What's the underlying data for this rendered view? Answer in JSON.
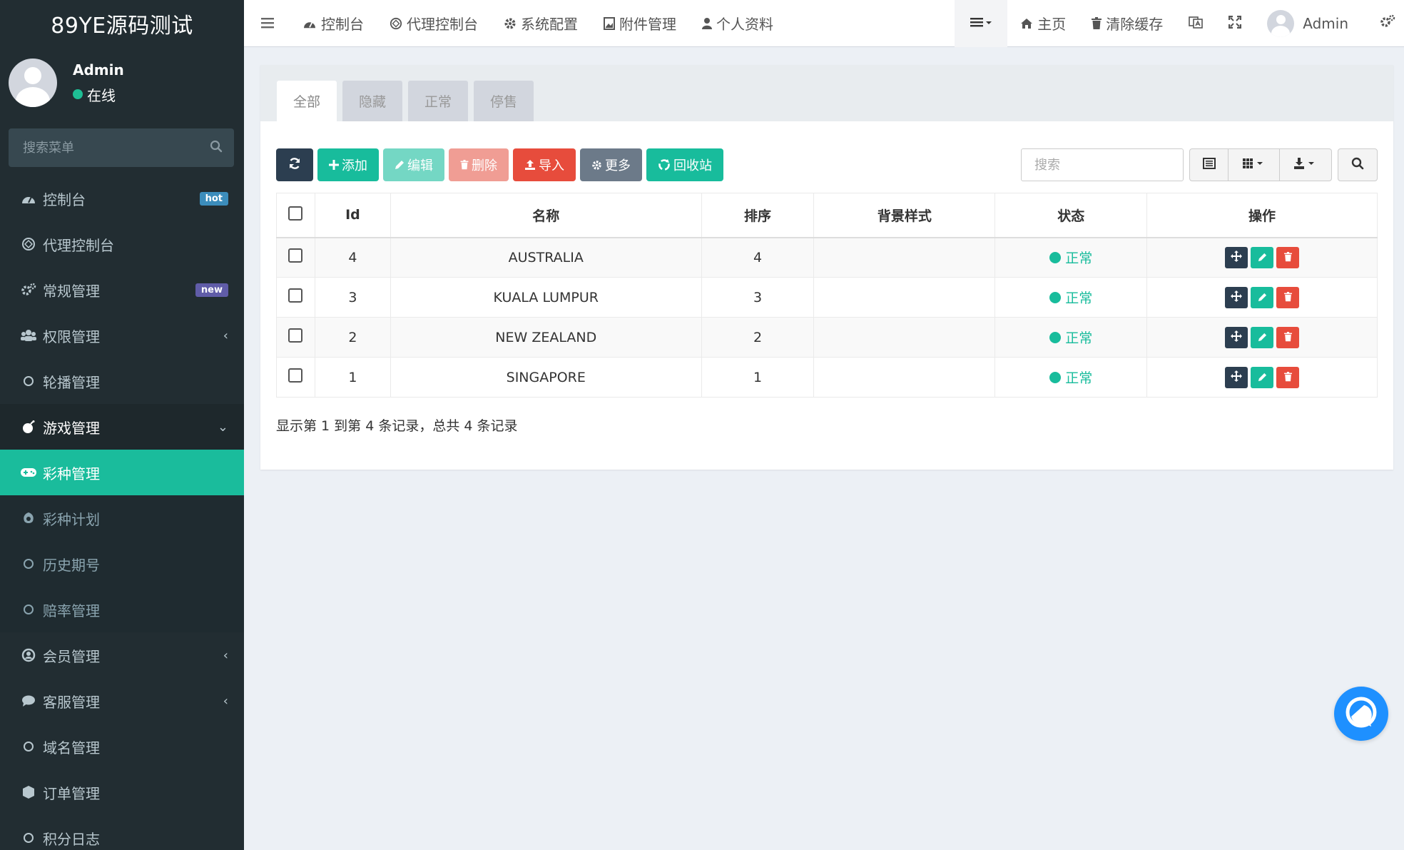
{
  "sidebar": {
    "logo": "89YE源码测试",
    "user": {
      "name": "Admin",
      "status": "在线"
    },
    "search_placeholder": "搜索菜单",
    "items": [
      {
        "label": "控制台",
        "icon": "dashboard-icon",
        "badge": "hot"
      },
      {
        "label": "代理控制台",
        "icon": "dashboard-icon"
      },
      {
        "label": "常规管理",
        "icon": "cogs-icon",
        "badge": "new"
      },
      {
        "label": "权限管理",
        "icon": "users-icon",
        "chevron": "left"
      },
      {
        "label": "轮播管理",
        "icon": "circle-icon"
      },
      {
        "label": "游戏管理",
        "icon": "bomb-icon",
        "chevron": "down"
      },
      {
        "label": "彩种管理",
        "icon": "gamepad-icon"
      },
      {
        "label": "彩种计划",
        "icon": "rebel-icon"
      },
      {
        "label": "历史期号",
        "icon": "circle-icon"
      },
      {
        "label": "赔率管理",
        "icon": "circle-icon"
      },
      {
        "label": "会员管理",
        "icon": "user-circle-icon",
        "chevron": "left"
      },
      {
        "label": "客服管理",
        "icon": "comment-icon",
        "chevron": "left"
      },
      {
        "label": "域名管理",
        "icon": "circle-icon"
      },
      {
        "label": "订单管理",
        "icon": "cube-icon"
      },
      {
        "label": "积分日志",
        "icon": "circle-icon"
      }
    ]
  },
  "topnav": {
    "left": [
      {
        "label": "控制台",
        "icon": "dashboard-icon"
      },
      {
        "label": "代理控制台",
        "icon": "dashboard-icon"
      },
      {
        "label": "系统配置",
        "icon": "gear-icon"
      },
      {
        "label": "附件管理",
        "icon": "image-icon"
      },
      {
        "label": "个人资料",
        "icon": "user-icon"
      }
    ],
    "right": [
      {
        "label": "主页",
        "icon": "home-icon"
      },
      {
        "label": "清除缓存",
        "icon": "trash-icon"
      }
    ],
    "username": "Admin"
  },
  "tabs": [
    "全部",
    "隐藏",
    "正常",
    "停售"
  ],
  "toolbar": {
    "add": "添加",
    "edit": "编辑",
    "delete": "删除",
    "import": "导入",
    "more": "更多",
    "recycle": "回收站",
    "search_placeholder": "搜索"
  },
  "table": {
    "columns": [
      "Id",
      "名称",
      "排序",
      "背景样式",
      "状态",
      "操作"
    ],
    "rows": [
      {
        "id": "4",
        "name": "AUSTRALIA",
        "sort": "4",
        "bg": "",
        "status": "正常"
      },
      {
        "id": "3",
        "name": "KUALA LUMPUR",
        "sort": "3",
        "bg": "",
        "status": "正常"
      },
      {
        "id": "2",
        "name": "NEW ZEALAND",
        "sort": "2",
        "bg": "",
        "status": "正常"
      },
      {
        "id": "1",
        "name": "SINGAPORE",
        "sort": "1",
        "bg": "",
        "status": "正常"
      }
    ]
  },
  "pagination_info": "显示第 1 到第 4 条记录，总共 4 条记录",
  "colors": {
    "sidebar_bg": "#222d32",
    "accent": "#18bc9c",
    "danger": "#e74c3c",
    "dark": "#2c3e50"
  }
}
